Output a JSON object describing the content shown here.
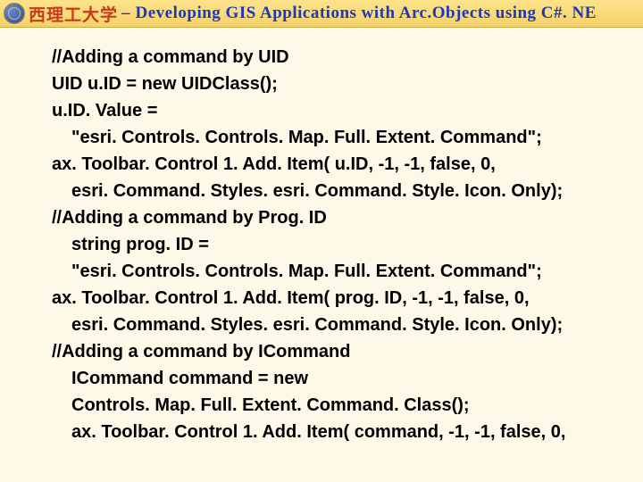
{
  "header": {
    "university": "西理工大学",
    "separator": "–",
    "subtitle": "Developing GIS Applications with Arc.Objects using C#. NE"
  },
  "content": {
    "lines": [
      {
        "text": "//Adding a command by UID",
        "indent": 0
      },
      {
        "text": "UID u.ID = new UIDClass();",
        "indent": 0
      },
      {
        "text": "u.ID. Value =",
        "indent": 0
      },
      {
        "text": "\"esri. Controls. Controls. Map. Full. Extent. Command\";",
        "indent": 1
      },
      {
        "text": "ax. Toolbar. Control 1. Add. Item( u.ID, -1, -1, false, 0,",
        "indent": 0
      },
      {
        "text": "esri. Command. Styles. esri. Command. Style. Icon. Only);",
        "indent": 1
      },
      {
        "text": "//Adding a command by Prog. ID",
        "indent": 0
      },
      {
        "text": "string prog. ID =",
        "indent": 1
      },
      {
        "text": "\"esri. Controls. Controls. Map. Full. Extent. Command\";",
        "indent": 1
      },
      {
        "text": "ax. Toolbar. Control 1. Add. Item( prog. ID, -1, -1, false, 0,",
        "indent": 0
      },
      {
        "text": "esri. Command. Styles. esri. Command. Style. Icon. Only);",
        "indent": 1
      },
      {
        "text": "//Adding a command by ICommand",
        "indent": 0
      },
      {
        "text": "ICommand command = new",
        "indent": 1
      },
      {
        "text": "Controls. Map. Full. Extent. Command. Class();",
        "indent": 1
      },
      {
        "text": "ax. Toolbar. Control 1. Add. Item( command, -1, -1, false, 0,",
        "indent": 1
      }
    ]
  }
}
